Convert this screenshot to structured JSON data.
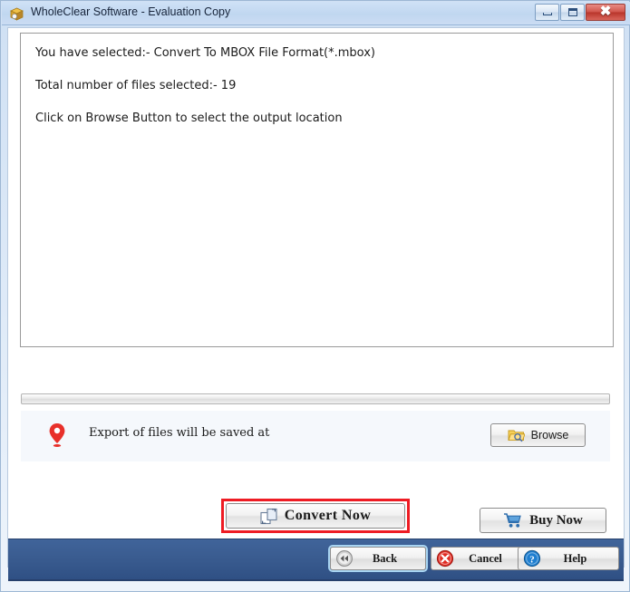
{
  "window": {
    "title": "WholeClear Software - Evaluation Copy",
    "icon": "app-box-icon",
    "controls": {
      "minimize": "Minimize",
      "maximize": "Maximize",
      "close": "Close"
    }
  },
  "info_panel": {
    "lines": [
      "You have selected:-  Convert To MBOX File Format(*.mbox)",
      "Total number of files selected:-  19",
      "Click on Browse Button to select the output location"
    ],
    "selected_format": "Convert To MBOX File Format(*.mbox)",
    "total_files_selected": "19"
  },
  "progress": {
    "value": 0,
    "value_text": "0%"
  },
  "export": {
    "label": "Export of files will be saved at",
    "path_value": "",
    "browse_label": "Browse",
    "pin_icon": "location-pin-icon",
    "folder_icon": "folder-search-icon"
  },
  "actions": {
    "convert_label": "Convert Now",
    "convert_icon": "convert-pages-icon",
    "convert_highlight_color": "#ee1c24",
    "buy_label": "Buy Now",
    "buy_icon": "shopping-cart-icon"
  },
  "navbar": {
    "back_label": "Back",
    "back_icon": "rewind-circle-icon",
    "cancel_label": "Cancel",
    "cancel_icon": "red-x-circle-icon",
    "help_label": "Help",
    "help_icon": "blue-question-circle-icon",
    "bar_color": "#3a5c90"
  }
}
